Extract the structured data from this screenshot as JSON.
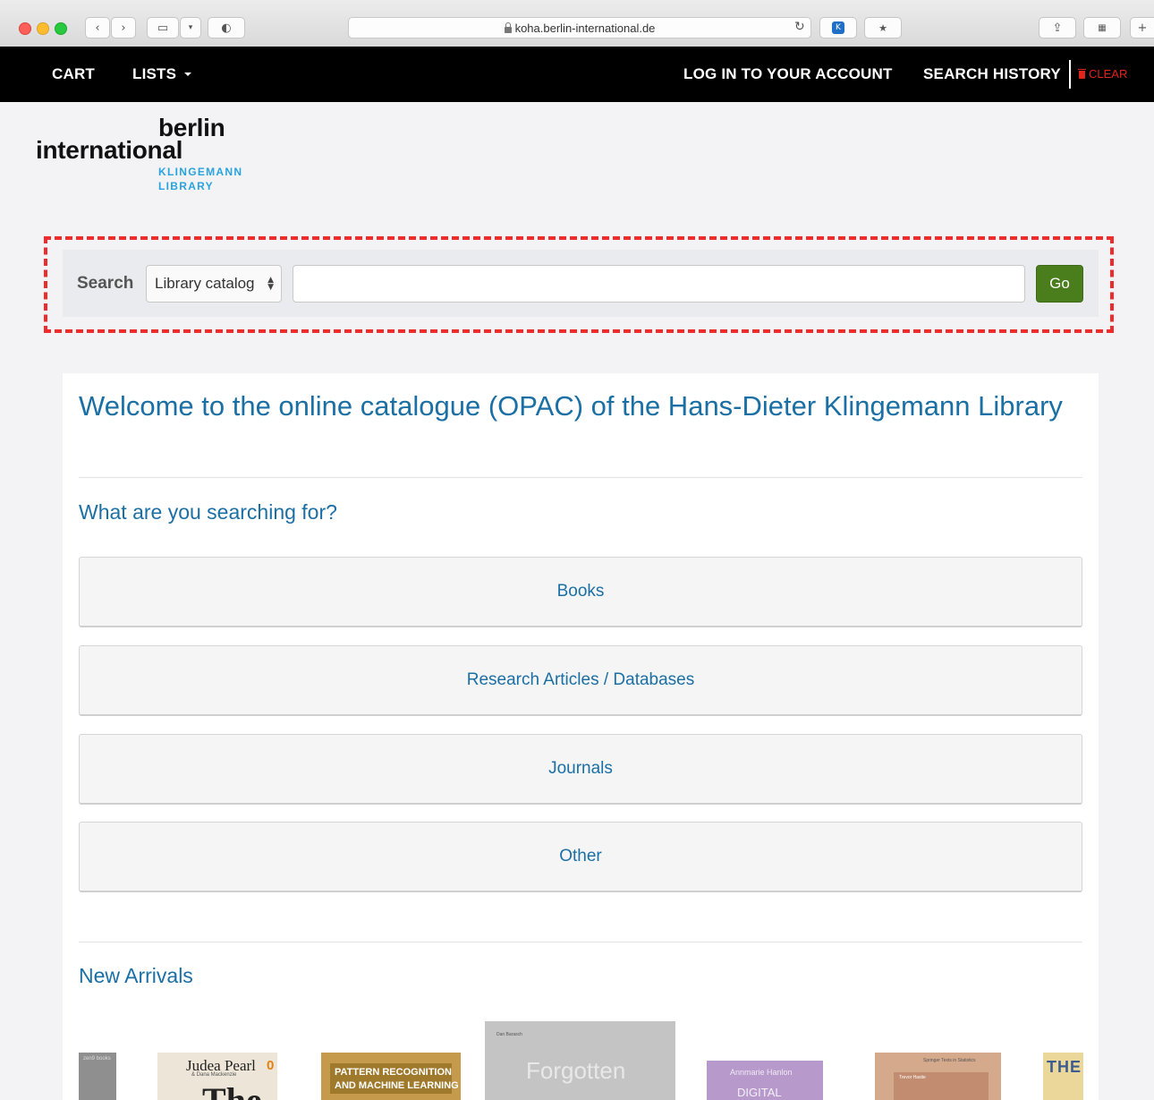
{
  "browser": {
    "url": "koha.berlin-international.de"
  },
  "nav": {
    "cart": "CART",
    "lists": "LISTS",
    "login": "LOG IN TO YOUR ACCOUNT",
    "search_history": "SEARCH HISTORY",
    "clear": "CLEAR"
  },
  "logo": {
    "line1": "berlin",
    "line2": "international",
    "line3": "KLINGEMANN",
    "line4": "LIBRARY"
  },
  "search": {
    "label": "Search",
    "scope": "Library catalog",
    "query": "",
    "go": "Go"
  },
  "main": {
    "welcome": "Welcome to the online catalogue (OPAC) of the Hans-Dieter Klingemann Library",
    "question": "What are you searching for?",
    "categories": [
      "Books",
      "Research Articles / Databases",
      "Journals",
      "Other"
    ],
    "new_arrivals": "New Arrivals"
  },
  "covers": {
    "c1": "zen9 books",
    "c2_author": "Judea Pearl",
    "c2_sub": "& Dana Mackenzie",
    "c2_badge": "0",
    "c2_title": "The",
    "c3_line1": "PATTERN RECOGNITION",
    "c3_line2": "AND MACHINE LEARNING",
    "c4_author": "Dan Barasch",
    "c4_title": "Forgotten",
    "c5_author": "Annmarie Hanlon",
    "c5_title": "DIGITAL",
    "c6_top": "Springer Texts in Statistics",
    "c6_bar": "Trevor Hastie",
    "c7_title": "THE"
  },
  "colors": {
    "link": "#1a6fa5",
    "go_button": "#4a7d1c",
    "clear": "#e0231c",
    "highlight": "#ef2b2b"
  }
}
